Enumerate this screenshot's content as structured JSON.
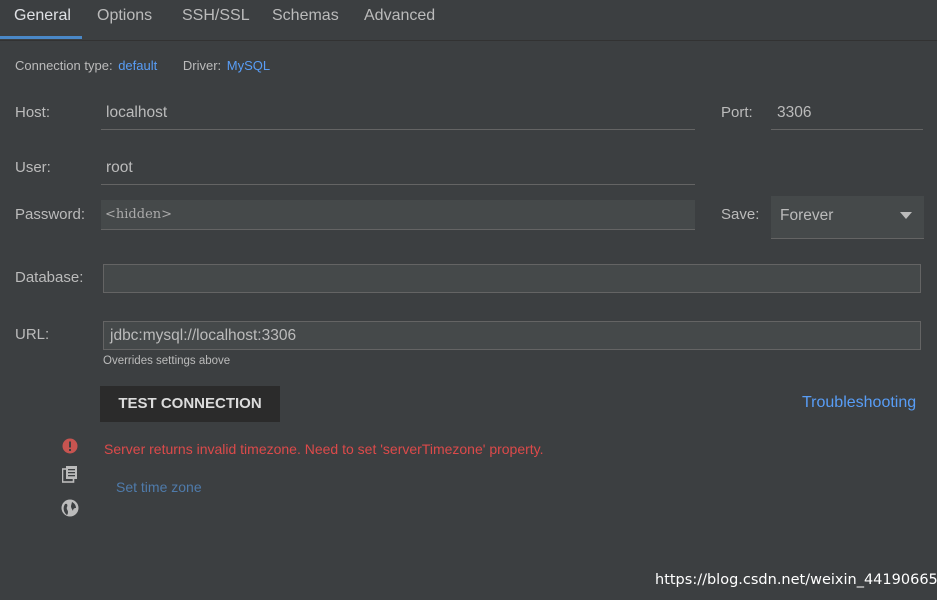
{
  "tabs": [
    {
      "label": "General"
    },
    {
      "label": "Options"
    },
    {
      "label": "SSH/SSL"
    },
    {
      "label": "Schemas"
    },
    {
      "label": "Advanced"
    }
  ],
  "info": {
    "connection_type_label": "Connection type:",
    "connection_type_value": "default",
    "driver_label": "Driver:",
    "driver_value": "MySQL"
  },
  "form": {
    "host_label": "Host:",
    "host_value": "localhost",
    "port_label": "Port:",
    "port_value": "3306",
    "user_label": "User:",
    "user_value": "root",
    "password_label": "Password:",
    "password_value": "<hidden>",
    "save_label": "Save:",
    "save_value": "Forever",
    "database_label": "Database:",
    "database_value": "",
    "url_label": "URL:",
    "url_value": "jdbc:mysql://localhost:3306",
    "url_hint": "Overrides settings above"
  },
  "actions": {
    "test_connection": "TEST CONNECTION",
    "troubleshooting": "Troubleshooting"
  },
  "status": {
    "error_message": "Server returns invalid timezone. Need to set 'serverTimezone' property.",
    "set_time_zone": "Set time zone"
  },
  "watermark": "https://blog.csdn.net/weixin_44190665",
  "colors": {
    "background": "#3c3f41",
    "accent": "#4a88c7",
    "link": "#589df6",
    "error": "#dc4a4a"
  },
  "icons": [
    "error-icon",
    "copy-icon",
    "globe-icon",
    "dropdown-arrow-icon"
  ]
}
